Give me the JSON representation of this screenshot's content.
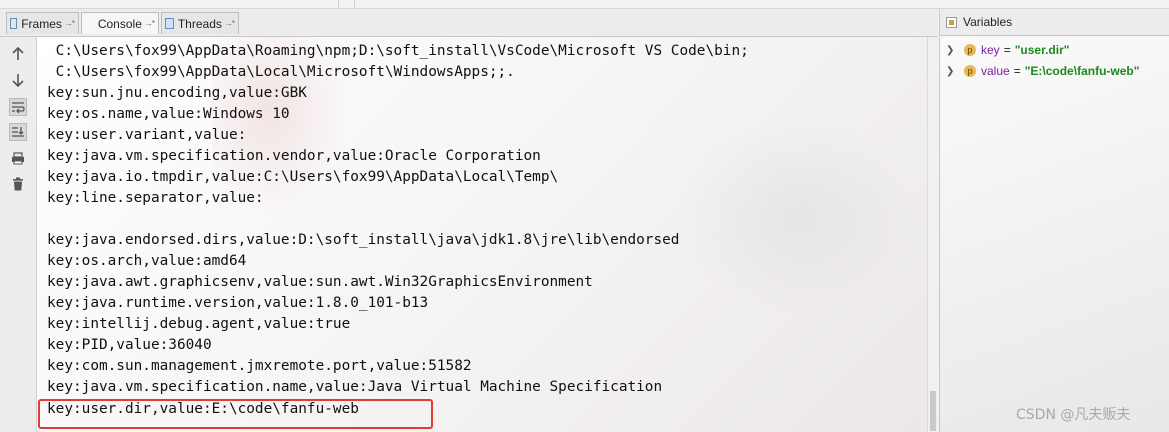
{
  "tabs": [
    {
      "label": "Frames",
      "pin": "→*",
      "icon": "frames-icon",
      "active": false
    },
    {
      "label": "Console",
      "pin": "→*",
      "icon": "console-icon",
      "active": true
    },
    {
      "label": "Threads",
      "pin": "→*",
      "icon": "threads-icon",
      "active": false
    }
  ],
  "variables_panel": {
    "title": "Variables",
    "items": [
      {
        "name": "key",
        "eq": "=",
        "value": "\"user.dir\"",
        "badge": "p"
      },
      {
        "name": "value",
        "eq": "=",
        "value": "\"E:\\code\\fanfu-web\"",
        "badge": "p"
      }
    ]
  },
  "toolbar": {
    "buttons": [
      "up-arrow-icon",
      "down-arrow-icon",
      "soft-wrap-icon",
      "scroll-to-end-icon",
      "print-icon",
      "trash-icon"
    ]
  },
  "console": {
    "lines": [
      " C:\\Users\\fox99\\AppData\\Roaming\\npm;D:\\soft_install\\VsCode\\Microsoft VS Code\\bin;",
      " C:\\Users\\fox99\\AppData\\Local\\Microsoft\\WindowsApps;;.",
      "key:sun.jnu.encoding,value:GBK",
      "key:os.name,value:Windows 10",
      "key:user.variant,value:",
      "key:java.vm.specification.vendor,value:Oracle Corporation",
      "key:java.io.tmpdir,value:C:\\Users\\fox99\\AppData\\Local\\Temp\\",
      "key:line.separator,value:",
      "",
      "key:java.endorsed.dirs,value:D:\\soft_install\\java\\jdk1.8\\jre\\lib\\endorsed",
      "key:os.arch,value:amd64",
      "key:java.awt.graphicsenv,value:sun.awt.Win32GraphicsEnvironment",
      "key:java.runtime.version,value:1.8.0_101-b13",
      "key:intellij.debug.agent,value:true",
      "key:PID,value:36040",
      "key:com.sun.management.jmxremote.port,value:51582",
      "key:java.vm.specification.name,value:Java Virtual Machine Specification",
      "key:user.dir,value:E:\\code\\fanfu-web"
    ]
  },
  "watermark": "CSDN @凡夫贩夫"
}
